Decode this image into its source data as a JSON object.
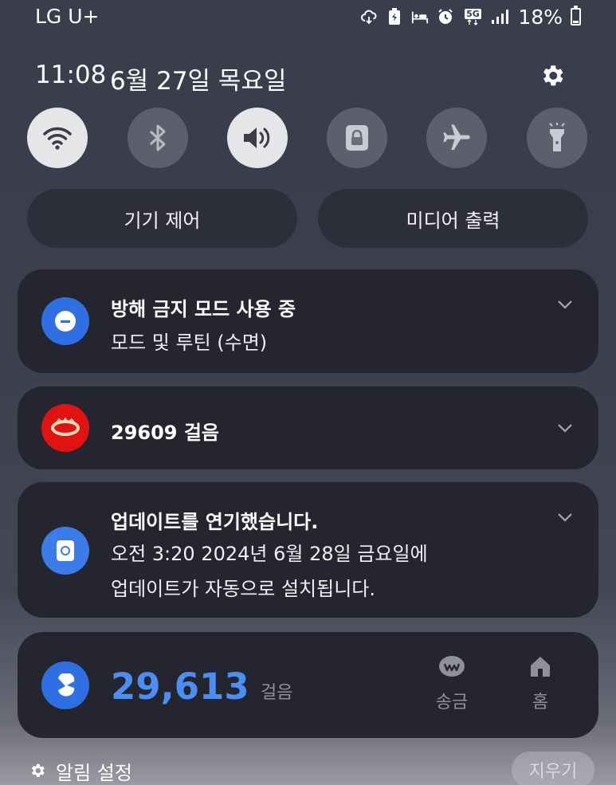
{
  "status_bar": {
    "carrier": "LG U+",
    "network": "5G",
    "battery": "18%",
    "icons": [
      "cloud-sync-icon",
      "battery-saver-icon",
      "sleep-icon",
      "alarm-icon",
      "network-5g-icon",
      "signal-icon"
    ]
  },
  "header": {
    "time": "11:08",
    "date": "6월 27일 목요일"
  },
  "quick_settings": [
    {
      "name": "wifi",
      "icon": "wifi-icon",
      "active": true
    },
    {
      "name": "bluetooth",
      "icon": "bluetooth-icon",
      "active": false
    },
    {
      "name": "sound",
      "icon": "speaker-icon",
      "active": true
    },
    {
      "name": "lock",
      "icon": "lock-icon",
      "active": false
    },
    {
      "name": "airplane",
      "icon": "airplane-icon",
      "active": false
    },
    {
      "name": "flashlight",
      "icon": "flashlight-icon",
      "active": false
    }
  ],
  "controls": {
    "device_control": "기기 제어",
    "media_output": "미디어 출력"
  },
  "notifications": [
    {
      "title": "방해 금지 모드 사용 중",
      "body": "모드 및 루틴 (수면)",
      "icon": "dnd-icon",
      "color": "#2f6fe4"
    },
    {
      "title": "29609 걸음",
      "icon": "dashin-logo-icon",
      "color": "#e01212"
    },
    {
      "title": "업데이트를 연기했습니다.",
      "body_line1": "오전 3:20 2024년 6월 28일 금요일에",
      "body_line2": "업데이트가 자동으로 설치됩니다.",
      "icon": "software-update-icon",
      "color": "#3a7de8"
    }
  ],
  "steps_widget": {
    "value": "29,613",
    "unit": "걸음",
    "icon": "toss-icon",
    "send_label": "송금",
    "home_label": "홈"
  },
  "footer": {
    "settings_label": "알림 설정",
    "clear_label": "지우기"
  },
  "colors": {
    "accent_blue": "#4c8ef4",
    "card_bg": "#24252f"
  }
}
